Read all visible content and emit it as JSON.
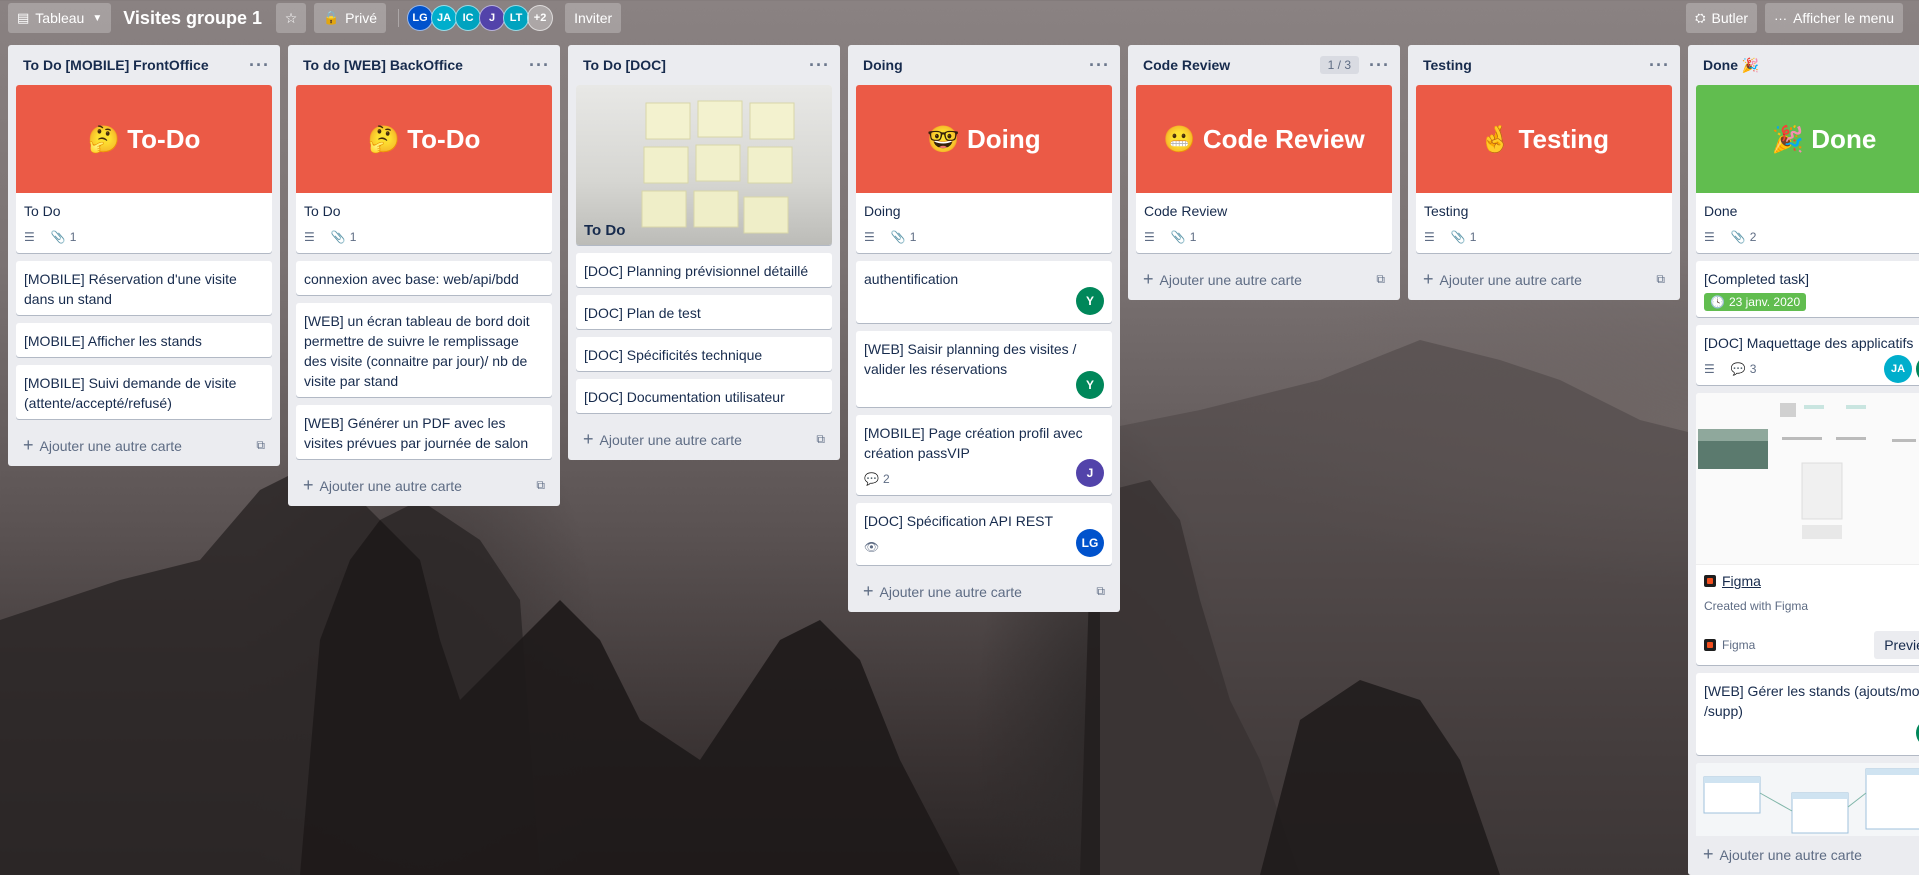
{
  "header": {
    "board_view_label": "Tableau",
    "board_title": "Visites groupe 1",
    "visibility_label": "Privé",
    "members": [
      {
        "initials": "LG",
        "color": "#0052cc"
      },
      {
        "initials": "JA",
        "color": "#00aecc"
      },
      {
        "initials": "IC",
        "color": "#00a3bf"
      },
      {
        "initials": "J",
        "color": "#5243aa"
      },
      {
        "initials": "LT",
        "color": "#00a3bf"
      }
    ],
    "more_members": "+2",
    "invite_label": "Inviter",
    "butler_label": "Butler",
    "menu_label": "Afficher le menu"
  },
  "add_card_label": "Ajouter une autre carte",
  "lists": [
    {
      "title": "To Do [MOBILE] FrontOffice",
      "cover_text": "🤔 To-Do",
      "cover_title": "To Do",
      "cover_attachments": "1",
      "cards": [
        "[MOBILE] Réservation d'une visite dans un stand",
        "[MOBILE] Afficher les stands",
        "[MOBILE] Suivi demande de visite (attente/accepté/refusé)"
      ]
    },
    {
      "title": "To do [WEB] BackOffice",
      "cover_text": "🤔 To-Do",
      "cover_title": "To Do",
      "cover_attachments": "1",
      "cards": [
        "connexion avec base: web/api/bdd",
        "[WEB] un écran tableau de bord doit permettre de suivre le remplissage des visite (connaitre par jour)/ nb de visite par stand",
        "[WEB] Générer un PDF avec les visites prévues par journée de salon"
      ]
    },
    {
      "title": "To Do [DOC]",
      "cover_title": "To Do",
      "cards": [
        "[DOC] Planning prévisionnel détaillé",
        "[DOC] Plan de test",
        "[DOC] Spécificités technique",
        "[DOC] Documentation utilisateur"
      ]
    },
    {
      "title": "Doing",
      "cover_text": "🤓 Doing",
      "cover_title": "Doing",
      "cover_attachments": "1",
      "cards": [
        {
          "title": "authentification",
          "member": "Y",
          "member_color": "#00875a"
        },
        {
          "title": "[WEB] Saisir planning des visites / valider les réservations",
          "member": "Y",
          "member_color": "#00875a"
        },
        {
          "title": "[MOBILE] Page création profil avec création passVIP",
          "comments": "2",
          "member": "J",
          "member_color": "#5243aa"
        },
        {
          "title": "[DOC] Spécification API REST",
          "member": "LG",
          "member_color": "#0052cc"
        }
      ]
    },
    {
      "title": "Code Review",
      "limit": "1 / 3",
      "cover_text": "😬 Code Review",
      "cover_title": "Code Review",
      "cover_attachments": "1"
    },
    {
      "title": "Testing",
      "cover_text": "🤞 Testing",
      "cover_title": "Testing",
      "cover_attachments": "1"
    },
    {
      "title": "Done 🎉",
      "cover_text": "🎉 Done",
      "cover_title": "Done",
      "cover_attachments": "2",
      "completed_task": "[Completed task]",
      "completed_due": "23 janv. 2020",
      "maquettage_title": "[DOC] Maquettage des applicatifs",
      "maquettage_comments": "3",
      "maquettage_members": [
        {
          "initials": "JA",
          "color": "#00aecc"
        },
        {
          "initials": "Y",
          "color": "#00875a"
        }
      ],
      "figma_link": "Figma",
      "figma_sub": "Created with Figma",
      "figma_source": "Figma",
      "preview_label": "Preview",
      "stands_title": "[WEB] Gérer les stands (ajouts/modif /supp)",
      "stands_member": "Y"
    }
  ]
}
